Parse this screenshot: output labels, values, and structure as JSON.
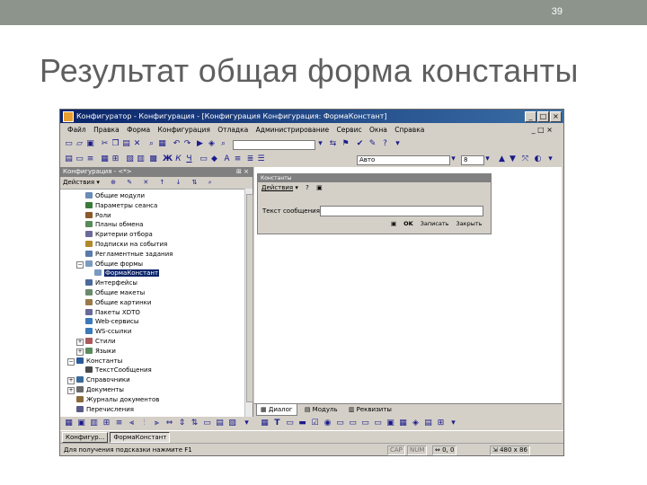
{
  "slide": {
    "number": "39",
    "title": "Результат общая форма константы"
  },
  "app": {
    "window_title": "Конфигуратор - Конфигурация - [Конфигурация Конфигурация: ФормаКонстант]",
    "menu": [
      "Файл",
      "Правка",
      "Форма",
      "Конфигурация",
      "Отладка",
      "Администрирование",
      "Сервис",
      "Окна",
      "Справка"
    ],
    "toolbar": {
      "font_value": "Авто",
      "size_value": "8"
    }
  },
  "config_panel": {
    "title": "Конфигурация - <*>",
    "actions_label": "Действия ▾",
    "tree": [
      {
        "label": "Общие модули",
        "level": 2,
        "icon": "module-icon",
        "color": "#6b8bb8"
      },
      {
        "label": "Параметры сеанса",
        "level": 2,
        "icon": "param-icon",
        "color": "#3a7a3a"
      },
      {
        "label": "Роли",
        "level": 2,
        "icon": "role-icon",
        "color": "#8a5a2a"
      },
      {
        "label": "Планы обмена",
        "level": 2,
        "icon": "exchange-icon",
        "color": "#5a8a5a"
      },
      {
        "label": "Критерии отбора",
        "level": 2,
        "icon": "filter-icon",
        "color": "#6a6a9a"
      },
      {
        "label": "Подписки на события",
        "level": 2,
        "icon": "event-icon",
        "color": "#b08a2a"
      },
      {
        "label": "Регламентные задания",
        "level": 2,
        "icon": "clock-icon",
        "color": "#5a7aaa"
      },
      {
        "label": "Общие формы",
        "level": 2,
        "icon": "form-icon",
        "color": "#7a9ac0",
        "expanded": true
      },
      {
        "label": "ФормаКонстант",
        "level": 3,
        "icon": "form-icon",
        "color": "#7a9ac0",
        "selected": true
      },
      {
        "label": "Интерфейсы",
        "level": 2,
        "icon": "interface-icon",
        "color": "#4a6a9a"
      },
      {
        "label": "Общие макеты",
        "level": 2,
        "icon": "template-icon",
        "color": "#6a8a6a"
      },
      {
        "label": "Общие картинки",
        "level": 2,
        "icon": "picture-icon",
        "color": "#9a7a4a"
      },
      {
        "label": "Пакеты XDTO",
        "level": 2,
        "icon": "package-icon",
        "color": "#6a6a9a"
      },
      {
        "label": "Web-сервисы",
        "level": 2,
        "icon": "web-icon",
        "color": "#3a7aba"
      },
      {
        "label": "WS-ссылки",
        "level": 2,
        "icon": "link-icon",
        "color": "#3a7aba"
      },
      {
        "label": "Стили",
        "level": 2,
        "icon": "style-icon",
        "color": "#aa5a5a",
        "collapsed": true
      },
      {
        "label": "Языки",
        "level": 2,
        "icon": "language-icon",
        "color": "#5a8a5a",
        "collapsed": true
      },
      {
        "label": "Константы",
        "level": 1,
        "icon": "constant-icon",
        "color": "#2a5a9a",
        "expanded": true
      },
      {
        "label": "ТекстСообщения",
        "level": 2,
        "icon": "attribute-icon",
        "color": "#4a4a4a"
      },
      {
        "label": "Справочники",
        "level": 1,
        "icon": "catalog-icon",
        "color": "#3a6a9a",
        "collapsed": true
      },
      {
        "label": "Документы",
        "level": 1,
        "icon": "document-icon",
        "color": "#6a6a6a",
        "collapsed": true
      },
      {
        "label": "Журналы документов",
        "level": 1,
        "icon": "journal-icon",
        "color": "#8a6a3a"
      },
      {
        "label": "Перечисления",
        "level": 1,
        "icon": "enum-icon",
        "color": "#5a5a8a"
      }
    ]
  },
  "form_editor": {
    "form_title": "Константы",
    "actions_label": "Действия",
    "field_label": "Текст сообщения:",
    "buttons": [
      "OK",
      "Записать",
      "Закрыть"
    ],
    "tabs": [
      "Диалог",
      "Модуль",
      "Реквизиты"
    ]
  },
  "taskbar": [
    "Конфигур...",
    "ФормаКонстант"
  ],
  "status": {
    "hint": "Для получения подсказки нажмите F1",
    "cap": "CAP",
    "num": "NUM",
    "coords": "0, 0",
    "size": "480 x 86"
  }
}
